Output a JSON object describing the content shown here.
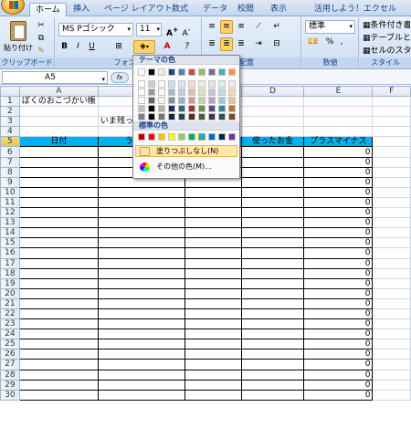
{
  "tabs": [
    "ホーム",
    "挿入",
    "ページ レイアウト",
    "数式",
    "データ",
    "校閲",
    "表示",
    "活用しよう！エクセル"
  ],
  "ribbon": {
    "paste_label": "貼り付け",
    "font_name": "MS Pゴシック",
    "font_size": "11",
    "number_format": "標準",
    "groups": {
      "clipboard": "クリップボード",
      "font": "フォント",
      "alignment": "配置",
      "number": "数値",
      "styles": "スタイル"
    },
    "style_items": [
      "条件付き書式",
      "テーブルとして",
      "セルのスタイル"
    ]
  },
  "formula_bar": {
    "name_box": "A5",
    "fx": "fx"
  },
  "sheet": {
    "columns": [
      "A",
      "B",
      "C",
      "D",
      "E",
      "F"
    ],
    "rows": {
      "r1": "ぼくのおこづかい帳",
      "r3": "いま残っているお",
      "h_a": "日付",
      "h_b": "うちわけ",
      "h_d": "使ったお金",
      "h_e": "プラスマイナス",
      "zero": "0"
    }
  },
  "palette": {
    "theme_title": "テーマの色",
    "standard_title": "標準の色",
    "no_fill": "塗りつぶしなし(N)",
    "more_colors": "その他の色(M)...",
    "theme_colors": [
      "#ffffff",
      "#000000",
      "#eeece1",
      "#1f497d",
      "#4f81bd",
      "#c0504d",
      "#9bbb59",
      "#8064a2",
      "#4bacc6",
      "#f79646"
    ],
    "standard_colors": [
      "#c00000",
      "#ff0000",
      "#ffc000",
      "#ffff00",
      "#92d050",
      "#00b050",
      "#00b0f0",
      "#0070c0",
      "#002060",
      "#7030a0"
    ]
  }
}
